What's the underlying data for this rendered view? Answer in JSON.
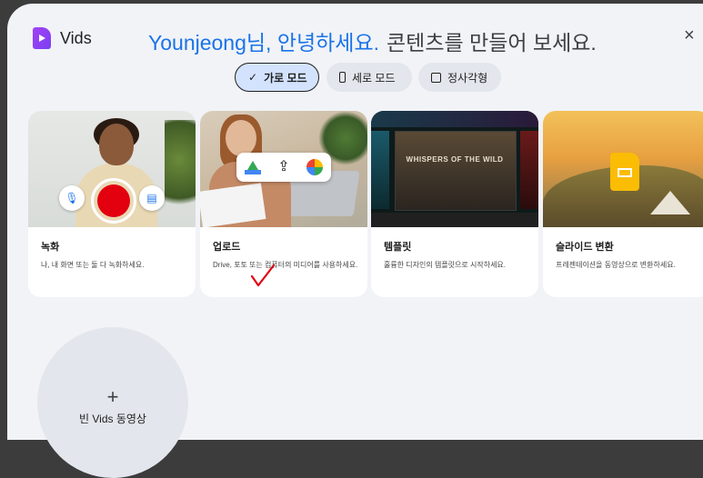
{
  "app": {
    "name": "Vids"
  },
  "header": {
    "greeting_name": "Younjeong님, 안녕하세요.",
    "greeting_rest": "콘텐츠를 만들어 보세요.",
    "close_symbol": "×"
  },
  "modes": [
    {
      "label": "가로 모드",
      "icon": "check-icon",
      "selected": true
    },
    {
      "label": "세로 모드",
      "icon": "portrait-icon",
      "selected": false
    },
    {
      "label": "정사각형",
      "icon": "square-icon",
      "selected": false
    }
  ],
  "cards": [
    {
      "title": "녹화",
      "desc": "나, 내 화면 또는 둘 다 녹화하세요.",
      "icons": [
        "mic-icon",
        "record-icon",
        "slides-doc-icon"
      ]
    },
    {
      "title": "업로드",
      "desc": "Drive, 포토 또는 컴퓨터의 미디어를 사용하세요.",
      "icons": [
        "google-drive-icon",
        "upload-icon",
        "google-photos-icon"
      ]
    },
    {
      "title": "템플릿",
      "desc": "훌륭한 디자인의 템플릿으로 시작하세요.",
      "thumb_text": "WHISPERS OF THE WILD"
    },
    {
      "title": "슬라이드 변환",
      "desc": "프레젠테이션을 동영상으로 변환하세요.",
      "icons": [
        "google-slides-icon"
      ]
    }
  ],
  "blank": {
    "plus": "+",
    "label": "빈 Vids 동영상"
  },
  "colors": {
    "accent": "#1a73e8",
    "record": "#e3000f",
    "annotation": "#e3000f"
  }
}
